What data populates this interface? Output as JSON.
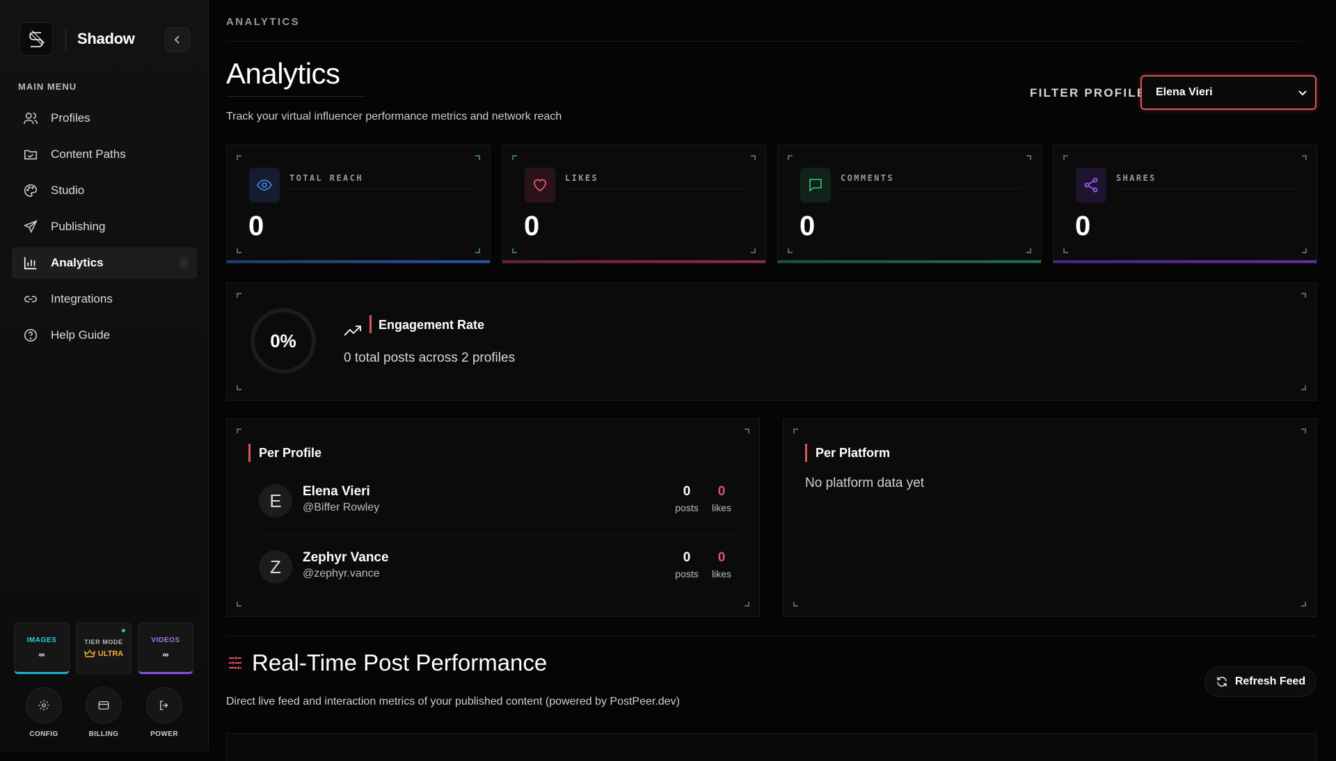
{
  "sidebar": {
    "brand": "Shadow",
    "menu_heading": "MAIN MENU",
    "items": [
      {
        "label": "Profiles",
        "icon": "users-icon"
      },
      {
        "label": "Content Paths",
        "icon": "folder-icon"
      },
      {
        "label": "Studio",
        "icon": "palette-icon"
      },
      {
        "label": "Publishing",
        "icon": "send-icon"
      },
      {
        "label": "Analytics",
        "icon": "bar-chart-icon",
        "active": true
      },
      {
        "label": "Integrations",
        "icon": "link-icon"
      },
      {
        "label": "Help Guide",
        "icon": "help-circle-icon"
      }
    ],
    "quotas": {
      "images": {
        "label": "IMAGES",
        "value": "∞"
      },
      "tier": {
        "label": "TIER MODE",
        "value": "ULTRA"
      },
      "videos": {
        "label": "VIDEOS",
        "value": "∞"
      }
    },
    "tools": {
      "config": "CONFIG",
      "billing": "BILLING",
      "power": "POWER"
    }
  },
  "header": {
    "breadcrumb": "ANALYTICS",
    "title": "Analytics",
    "subtitle": "Track your virtual influencer performance metrics and network reach",
    "filter_label": "FILTER PROFILE:",
    "filter_value": "Elena Vieri"
  },
  "stats": [
    {
      "label": "TOTAL REACH",
      "value": "0",
      "icon": "eye-icon",
      "color": "#3b6fd6"
    },
    {
      "label": "LIKES",
      "value": "0",
      "icon": "heart-icon",
      "color": "#e0507a"
    },
    {
      "label": "COMMENTS",
      "value": "0",
      "icon": "message-icon",
      "color": "#2aa86a"
    },
    {
      "label": "SHARES",
      "value": "0",
      "icon": "share-icon",
      "color": "#9a4fe0"
    }
  ],
  "engagement": {
    "rate": "0%",
    "title": "Engagement Rate",
    "subtitle": "0 total posts across 2 profiles"
  },
  "per_profile": {
    "title": "Per Profile",
    "rows": [
      {
        "initial": "E",
        "name": "Elena Vieri",
        "handle": "@Biffer Rowley",
        "posts": "0",
        "posts_label": "posts",
        "likes": "0",
        "likes_label": "likes"
      },
      {
        "initial": "Z",
        "name": "Zephyr Vance",
        "handle": "@zephyr.vance",
        "posts": "0",
        "posts_label": "posts",
        "likes": "0",
        "likes_label": "likes"
      }
    ]
  },
  "per_platform": {
    "title": "Per Platform",
    "empty": "No platform data yet"
  },
  "realtime": {
    "title": "Real-Time Post Performance",
    "subtitle": "Direct live feed and interaction metrics of your published content (powered by PostPeer.dev)",
    "refresh_label": "Refresh Feed"
  },
  "colors": {
    "accent_red": "#e0545c",
    "likes_pink": "#e0507a"
  }
}
